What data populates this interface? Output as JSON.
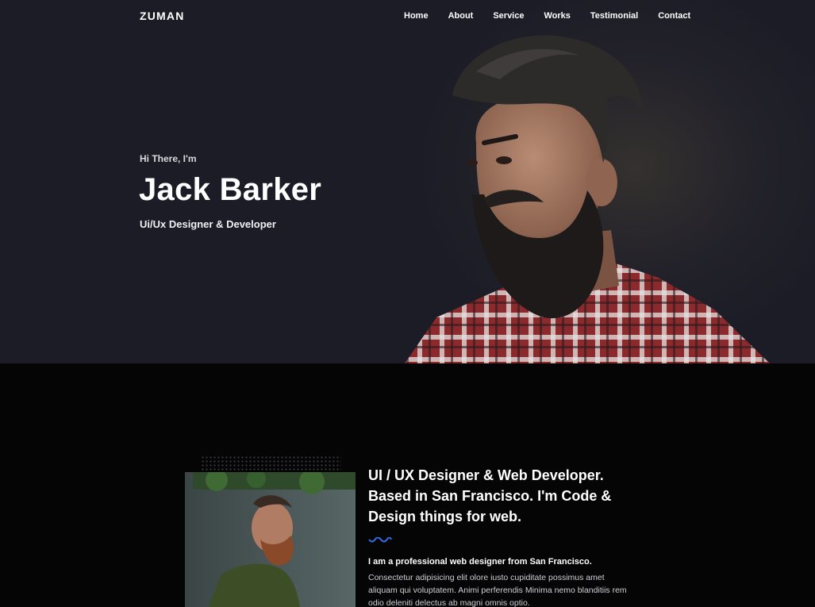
{
  "nav": {
    "logo": "ZUMAN",
    "items": [
      {
        "label": "Home",
        "active": true
      },
      {
        "label": "About",
        "active": false
      },
      {
        "label": "Service",
        "active": false
      },
      {
        "label": "Works",
        "active": false
      },
      {
        "label": "Testimonial",
        "active": false
      },
      {
        "label": "Contact",
        "active": false
      }
    ],
    "active_color": "#2f6ee8"
  },
  "hero": {
    "intro": "Hi There, I'm",
    "name": "Jack Barker",
    "role": "Ui/Ux Designer & Developer",
    "background": "#1b1c26"
  },
  "about": {
    "heading": "UI / UX Designer & Web Developer. Based in San Francisco. I'm Code & Design things for web.",
    "lead": "I am a professional web designer from San Francisco.",
    "body": "Consectetur adipisicing elit olore iusto cupiditate possimus amet aliquam qui voluptatem. Animi perferendis Minima nemo blanditiis rem odio deleniti delectus ab magni omnis optio.",
    "accent_color": "#2f6ee8"
  }
}
